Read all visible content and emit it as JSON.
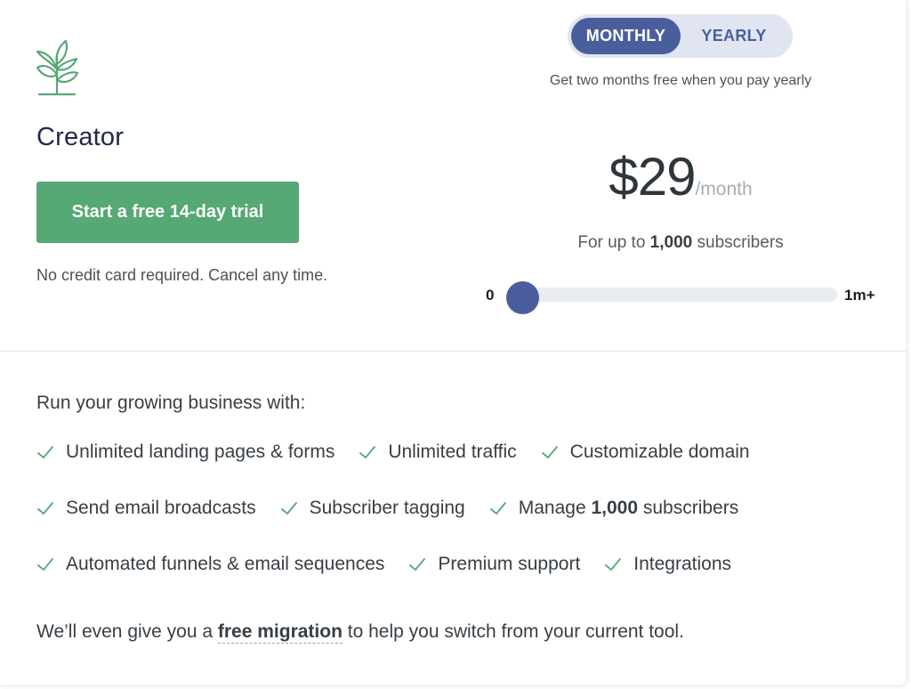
{
  "plan": {
    "name": "Creator",
    "trial_button": "Start a free 14-day trial",
    "trial_note": "No credit card required. Cancel any time."
  },
  "billing": {
    "monthly_label": "MONTHLY",
    "yearly_label": "YEARLY",
    "selected": "MONTHLY",
    "note": "Get two months free when you pay yearly"
  },
  "pricing": {
    "price": "$29",
    "period": "/month",
    "subs_prefix": "For up to ",
    "subs_count": "1,000",
    "subs_suffix": " subscribers"
  },
  "slider": {
    "min_label": "0",
    "max_label": "1m+",
    "position_fraction": 0.024
  },
  "features": {
    "heading": "Run your growing business with:",
    "row1": [
      "Unlimited landing pages & forms",
      "Unlimited traffic",
      "Customizable domain"
    ],
    "row2_a": "Send email broadcasts",
    "row2_b": "Subscriber tagging",
    "row2_c_prefix": "Manage ",
    "row2_c_count": "1,000",
    "row2_c_suffix": " subscribers",
    "row3": [
      "Automated funnels & email sequences",
      "Premium support",
      "Integrations"
    ]
  },
  "migration": {
    "prefix": "We’ll even give you a ",
    "link": "free migration",
    "suffix": " to help you switch from your current tool."
  },
  "colors": {
    "brand_green": "#56a874",
    "toggle_blue": "#4a5e9e",
    "toggle_bg": "#e0e5f1",
    "check_green": "#56a874"
  },
  "icons": {
    "logo": "sprout-icon",
    "check": "check-icon"
  }
}
